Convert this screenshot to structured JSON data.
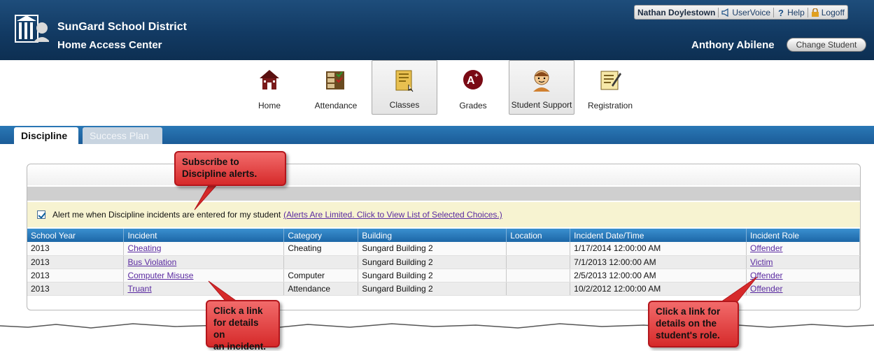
{
  "header": {
    "district": "SunGard School District",
    "app": "Home Access Center",
    "user": "Nathan Doylestown",
    "links": [
      "UserVoice",
      "Help",
      "Logoff"
    ],
    "student": "Anthony Abilene",
    "change_student": "Change Student"
  },
  "nav": {
    "items": [
      {
        "label": "Home",
        "icon": "home-icon"
      },
      {
        "label": "Attendance",
        "icon": "attendance-icon"
      },
      {
        "label": "Classes",
        "icon": "classes-icon"
      },
      {
        "label": "Grades",
        "icon": "grades-icon"
      },
      {
        "label": "Student Support",
        "icon": "student-support-icon"
      },
      {
        "label": "Registration",
        "icon": "registration-icon"
      }
    ]
  },
  "tabs": [
    "Discipline",
    "Success Plan"
  ],
  "alert": {
    "text": "Alert me when Discipline incidents are entered for my student",
    "link": "(Alerts Are Limited. Click to View List of Selected Choices.)"
  },
  "table": {
    "headers": [
      "School Year",
      "Incident",
      "Category",
      "Building",
      "Location",
      "Incident Date/Time",
      "Incident Role"
    ],
    "rows": [
      [
        "2013",
        "Cheating",
        "Cheating",
        "Sungard Building 2",
        "",
        "1/17/2014 12:00:00 AM",
        "Offender"
      ],
      [
        "2013",
        "Bus Violation",
        "",
        "Sungard Building 2",
        "",
        "7/1/2013 12:00:00 AM",
        "Victim"
      ],
      [
        "2013",
        "Computer Misuse",
        "Computer",
        "Sungard Building 2",
        "",
        "2/5/2013 12:00:00 AM",
        "Offender"
      ],
      [
        "2013",
        "Truant",
        "Attendance",
        "Sungard Building 2",
        "",
        "10/2/2012 12:00:00 AM",
        "Offender"
      ]
    ]
  },
  "callouts": {
    "subscribe": [
      "Subscribe to",
      "Discipline alerts."
    ],
    "incident": [
      "Click a link",
      "for details on",
      "an incident."
    ],
    "role": [
      "Click a link for",
      "details on the",
      "student's role."
    ]
  },
  "colors": {
    "header_bg": "#123a63",
    "tab_band": "#1b5c98",
    "callout_red": "#d62a2a",
    "alert_bg": "#f7f3d1"
  }
}
